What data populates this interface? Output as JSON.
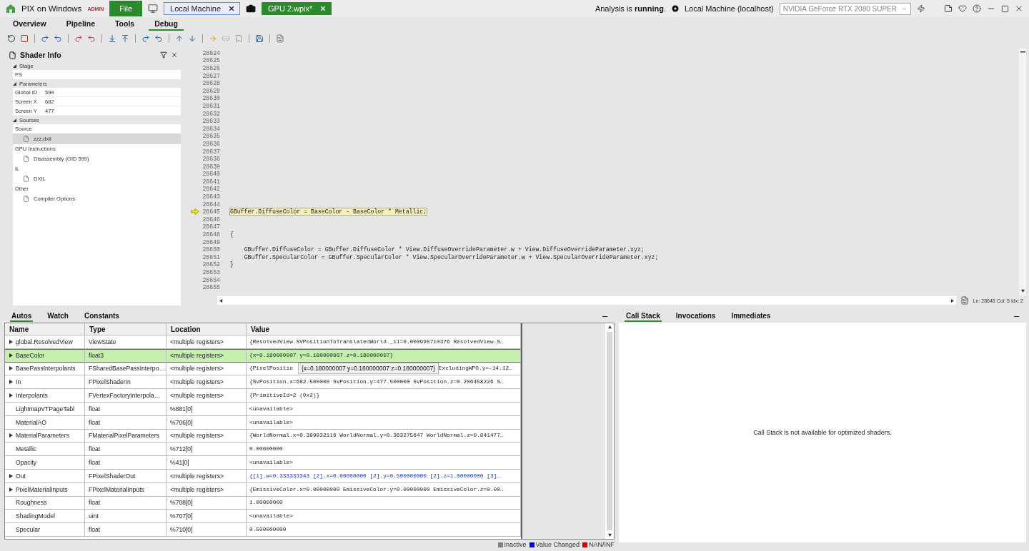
{
  "titlebar": {
    "app_name": "PIX on Windows",
    "badge": "ADMIN",
    "file_button": "File",
    "tabs": [
      {
        "label": "Local Machine",
        "kind": "machine",
        "selected": false
      },
      {
        "label": "GPU 2.wpix*",
        "kind": "capture",
        "selected": true
      }
    ],
    "status": "Analysis is **running**.",
    "machine": "Local Machine (localhost)",
    "gpu": "NVIDIA GeForce RTX 2080 SUPER"
  },
  "nav_tabs": [
    {
      "label": "Overview",
      "selected": false
    },
    {
      "label": "Pipeline",
      "selected": false
    },
    {
      "label": "Tools",
      "selected": false
    },
    {
      "label": "Debug",
      "selected": true
    }
  ],
  "shader_info": {
    "title": "Shader Info",
    "sections": [
      {
        "label": "Stage",
        "expanded": true,
        "kind": "value",
        "value": "PS"
      },
      {
        "label": "Parameters",
        "expanded": true,
        "kind": "params",
        "params": [
          {
            "key": "Global ID",
            "value": "599"
          },
          {
            "key": "Screen X",
            "value": "682"
          },
          {
            "key": "Screen Y",
            "value": "477"
          }
        ]
      },
      {
        "label": "Sources",
        "expanded": true,
        "kind": "groups",
        "groups": [
          {
            "label": "Source",
            "items": [
              {
                "label": "zzz.dxil",
                "selected": true
              }
            ]
          },
          {
            "label": "GPU Instructions",
            "items": [
              {
                "label": "Disassembly (GID 599)",
                "selected": false
              }
            ]
          },
          {
            "label": "IL",
            "items": [
              {
                "label": "DXIL",
                "selected": false
              }
            ]
          },
          {
            "label": "Other",
            "items": [
              {
                "label": "Compiler Options",
                "selected": false
              }
            ]
          }
        ]
      }
    ]
  },
  "code": {
    "lines": [
      {
        "number": "28624",
        "current": false
      },
      {
        "number": "28625",
        "current": false
      },
      {
        "number": "28626",
        "current": false
      },
      {
        "number": "28627",
        "current": false
      },
      {
        "number": "28628",
        "current": false
      },
      {
        "number": "28629",
        "current": false
      },
      {
        "number": "28630",
        "current": false
      },
      {
        "number": "28631",
        "current": false
      },
      {
        "number": "28632",
        "current": false
      },
      {
        "number": "28633",
        "current": false
      },
      {
        "number": "28634",
        "current": false
      },
      {
        "number": "28635",
        "current": false
      },
      {
        "number": "28636",
        "current": false
      },
      {
        "number": "28637",
        "current": false
      },
      {
        "number": "28638",
        "current": false
      },
      {
        "number": "28639",
        "current": false
      },
      {
        "number": "28640",
        "current": false
      },
      {
        "number": "28641",
        "current": false
      },
      {
        "number": "28642",
        "current": false
      },
      {
        "number": "28643",
        "current": false
      },
      {
        "number": "28644",
        "current": false
      },
      {
        "number": "28645",
        "current": true,
        "text": "GBuffer.DiffuseColor = BaseColor - BaseColor * Metallic;"
      },
      {
        "number": "28646",
        "current": false
      },
      {
        "number": "28647",
        "current": false
      },
      {
        "number": "28648",
        "current": false,
        "text": "{"
      },
      {
        "number": "28649",
        "current": false
      },
      {
        "number": "28650",
        "current": false,
        "text": "    GBuffer.DiffuseColor = GBuffer.DiffuseColor * View.DiffuseOverrideParameter.w + View.DiffuseOverrideParameter.xyz;"
      },
      {
        "number": "28651",
        "current": false,
        "text": "    GBuffer.SpecularColor = GBuffer.SpecularColor * View.SpecularOverrideParameter.w + View.SpecularOverrideParameter.xyz;"
      },
      {
        "number": "28652",
        "current": false,
        "text": "}"
      },
      {
        "number": "28653",
        "current": false
      },
      {
        "number": "28654",
        "current": false
      },
      {
        "number": "28655",
        "current": false
      }
    ],
    "status": "Ln: 28645  Col: 5  Idx: 2"
  },
  "autos": {
    "tabs": [
      {
        "label": "Autos",
        "selected": true
      },
      {
        "label": "Watch",
        "selected": false
      },
      {
        "label": "Constants",
        "selected": false
      }
    ],
    "columns": [
      "Name",
      "Type",
      "Location",
      "Value"
    ],
    "rows": [
      {
        "name": "global.ResolvedView",
        "type": "ViewState",
        "location": "<multiple registers>",
        "value": "{ResolvedView.SVPositionToTranslatedWorld._11=0.000995710376 ResolvedView.S…",
        "expandable": true,
        "selected": false,
        "changed": false
      },
      {
        "name": "BaseColor",
        "type": "float3",
        "location": "<multiple registers>",
        "value": "{x=0.180000007 y=0.180000007 z=0.180000007}",
        "expandable": true,
        "selected": true,
        "changed": false
      },
      {
        "name": "BasePassInterpolants",
        "type": "FSharedBasePassInterpo…",
        "location": "<multiple registers>",
        "value": "{PixelPositio",
        "value_after_tooltip": "ExcludingWPO.y=-14.12…",
        "expandable": true,
        "selected": false,
        "changed": false
      },
      {
        "name": "In",
        "type": "FPixelShaderIn",
        "location": "<multiple registers>",
        "value": "{SvPosition.x=682.500000 SvPosition.y=477.500000 SvPosition.z=0.206458226 S…",
        "expandable": true,
        "selected": false,
        "changed": false
      },
      {
        "name": "Interpolants",
        "type": "FVertexFactoryInterpola…",
        "location": "<multiple registers>",
        "value": "{PrimitiveId=2 (0x2)}",
        "expandable": true,
        "selected": false,
        "changed": false
      },
      {
        "name": "LightmapVTPageTabl",
        "type": "float",
        "location": "%881[0]",
        "value": "<unavailable>",
        "expandable": false,
        "selected": false,
        "changed": false
      },
      {
        "name": "MaterialAO",
        "type": "float",
        "location": "%706[0]",
        "value": "<unavailable>",
        "expandable": false,
        "selected": false,
        "changed": false
      },
      {
        "name": "MaterialParameters",
        "type": "FMaterialPixelParameters",
        "location": "<multiple registers>",
        "value": "{WorldNormal.x=0.399932116 WorldNormal.y=0.363275647 WorldNormal.z=0.841477…",
        "expandable": true,
        "selected": false,
        "changed": false
      },
      {
        "name": "Metallic",
        "type": "float",
        "location": "%712[0]",
        "value": "0.00000000",
        "expandable": false,
        "selected": false,
        "changed": false
      },
      {
        "name": "Opacity",
        "type": "float",
        "location": "%41[0]",
        "value": "<unavailable>",
        "expandable": false,
        "selected": false,
        "changed": false
      },
      {
        "name": "Out",
        "type": "FPixelShaderOut",
        "location": "<multiple registers>",
        "value": "{[1].w=0.333333343 [2].x=0.00000000 [2].y=0.500000000 [2].z=1.00000000 [3]…",
        "expandable": true,
        "selected": false,
        "changed": true
      },
      {
        "name": "PixelMaterialInputs",
        "type": "FPixelMaterialInputs",
        "location": "<multiple registers>",
        "value": "{EmissiveColor.x=0.00000000 EmissiveColor.y=0.00000000 EmissiveColor.z=0.00…",
        "expandable": true,
        "selected": false,
        "changed": false
      },
      {
        "name": "Roughness",
        "type": "float",
        "location": "%708[0]",
        "value": "1.00000000",
        "expandable": false,
        "selected": false,
        "changed": false
      },
      {
        "name": "ShadingModel",
        "type": "uint",
        "location": "%707[0]",
        "value": "<unavailable>",
        "expandable": false,
        "selected": false,
        "changed": false
      },
      {
        "name": "Specular",
        "type": "float",
        "location": "%710[0]",
        "value": "0.500000000",
        "expandable": false,
        "selected": false,
        "changed": false
      }
    ],
    "tooltip": "{x=0.180000007 y=0.180000007 z=0.180000007}",
    "legend": [
      {
        "label": "Inactive",
        "color": "#808080"
      },
      {
        "label": "Value Changed",
        "color": "#0000cc"
      },
      {
        "label": "NAN/INF",
        "color": "#cc0000"
      }
    ]
  },
  "callstack": {
    "tabs": [
      {
        "label": "Call Stack",
        "selected": true
      },
      {
        "label": "Invocations",
        "selected": false
      },
      {
        "label": "Immediates",
        "selected": false
      }
    ],
    "message": "Call Stack is not available for optimized shaders."
  }
}
